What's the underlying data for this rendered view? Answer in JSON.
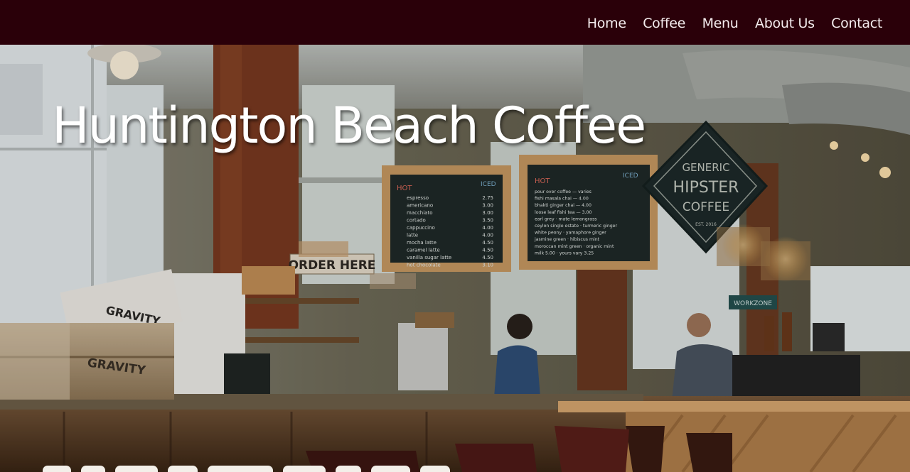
{
  "nav": {
    "items": [
      "Home",
      "Coffee",
      "Menu",
      "About Us",
      "Contact"
    ]
  },
  "hero": {
    "title": "Huntington Beach Coffee",
    "order_sign": "ORDER HERE",
    "brand_sign": {
      "line1": "GENERIC",
      "line2": "HIPSTER",
      "line3": "COFFEE",
      "line4": "EST. 2016"
    },
    "crate_label": "GRAVITY",
    "magazine_label": "GRAVITY",
    "work_sign": "WORKZONE",
    "menu_left": {
      "hot": "HOT",
      "iced": "ICED",
      "rows": [
        [
          "espresso",
          "2.75"
        ],
        [
          "americano",
          "3.00"
        ],
        [
          "macchiato",
          "3.00"
        ],
        [
          "cortado",
          "3.50"
        ],
        [
          "cappuccino",
          "4.00"
        ],
        [
          "latte",
          "4.00"
        ],
        [
          "mocha latte",
          "4.50"
        ],
        [
          "caramel latte",
          "4.50"
        ],
        [
          "vanilla sugar latte",
          "4.50"
        ],
        [
          "hot chocolate",
          "3.10"
        ]
      ]
    },
    "menu_right": {
      "hot": "HOT",
      "iced": "ICED",
      "rows": [
        "pour over coffee — varies",
        "fishi masala chai — 4.00",
        "bhakti ginger chai — 4.00",
        "loose leaf fishi tea — 3.00",
        "earl grey · mate lemongrass",
        "ceylon single estate · turmeric ginger",
        "white peony · yamaphore ginger",
        "jasmine green · hibiscus mint",
        "moroccan mint green · organic mint",
        "milk 5.00 · yours vary 3.25"
      ]
    },
    "colors": {
      "nav_bg": "#2a0009",
      "nav_text": "#f4ecee"
    }
  }
}
